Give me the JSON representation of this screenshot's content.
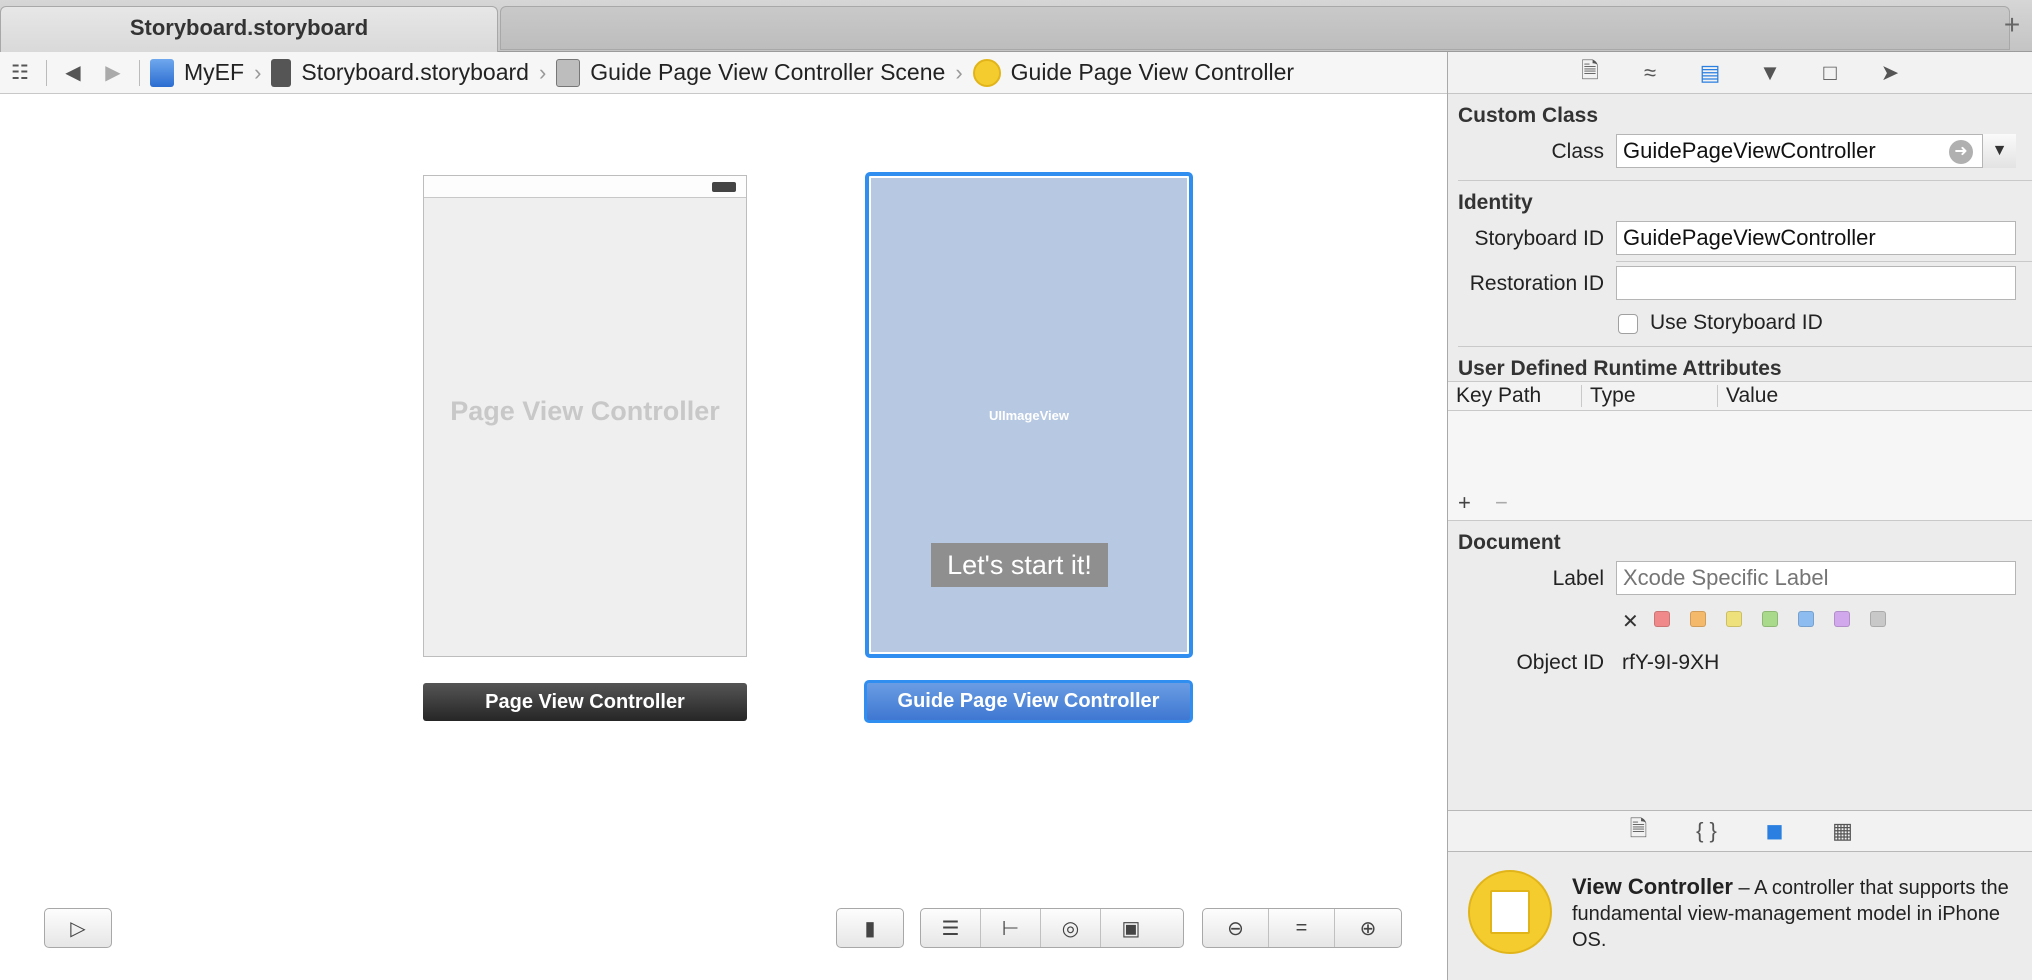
{
  "tabbar": {
    "active_tab": "Storyboard.storyboard",
    "add_icon": "+"
  },
  "jumpbar": {
    "grid_icon": "☷",
    "back_icon": "◀",
    "forward_icon": "▶",
    "crumbs": [
      {
        "label": "MyEF"
      },
      {
        "label": "Storyboard.storyboard"
      },
      {
        "label": "Guide Page View Controller Scene"
      },
      {
        "label": "Guide Page View Controller"
      }
    ],
    "chevron": "›"
  },
  "canvas": {
    "scene1": {
      "placeholder": "Page View Controller",
      "bar_label": "Page View Controller"
    },
    "scene2": {
      "image_view": "UIImageView",
      "button": "Let's start it!",
      "bar_label": "Guide Page View Controller"
    },
    "toolbar_icons": [
      "document-outline-toggle",
      "simulated-metrics",
      "align",
      "pin",
      "resolve",
      "resize",
      "zoom-out",
      "zoom-actual",
      "zoom-in"
    ]
  },
  "inspector": {
    "tabs": [
      "file-inspector-icon",
      "quick-help-icon",
      "identity-inspector-icon",
      "attributes-inspector-icon",
      "size-inspector-icon",
      "connections-inspector-icon"
    ],
    "custom_class": {
      "title": "Custom Class",
      "class_label": "Class",
      "class_value": "GuidePageViewController"
    },
    "identity": {
      "title": "Identity",
      "storyboard_id_label": "Storyboard ID",
      "storyboard_id_value": "GuidePageViewController",
      "restoration_id_label": "Restoration ID",
      "restoration_id_value": "",
      "use_storyboard_id_label": "Use Storyboard ID"
    },
    "runtime_attributes": {
      "title": "User Defined Runtime Attributes",
      "columns": [
        "Key Path",
        "Type",
        "Value"
      ],
      "add": "+",
      "remove": "−"
    },
    "document": {
      "title": "Document",
      "label_label": "Label",
      "label_placeholder": "Xcode Specific Label",
      "clear_icon": "✕",
      "swatch_colors": [
        "#f08a8a",
        "#f5b96b",
        "#eee07a",
        "#a9d98a",
        "#8cbcf0",
        "#d2a8ec",
        "#c8c8c8"
      ],
      "object_id_label": "Object ID",
      "object_id_value": "rfY-9I-9XH"
    },
    "library_tabs": [
      "file-template-icon",
      "code-snippet-icon",
      "object-library-icon",
      "media-library-icon"
    ],
    "library_item": {
      "title": "View Controller",
      "description": " – A controller that supports the fundamental view-management model in iPhone OS."
    }
  },
  "colors": {
    "accent": "#2f8ef0",
    "selected_scene_bg": "#b7c8e2",
    "vc_icon": "#f5cc2e"
  }
}
